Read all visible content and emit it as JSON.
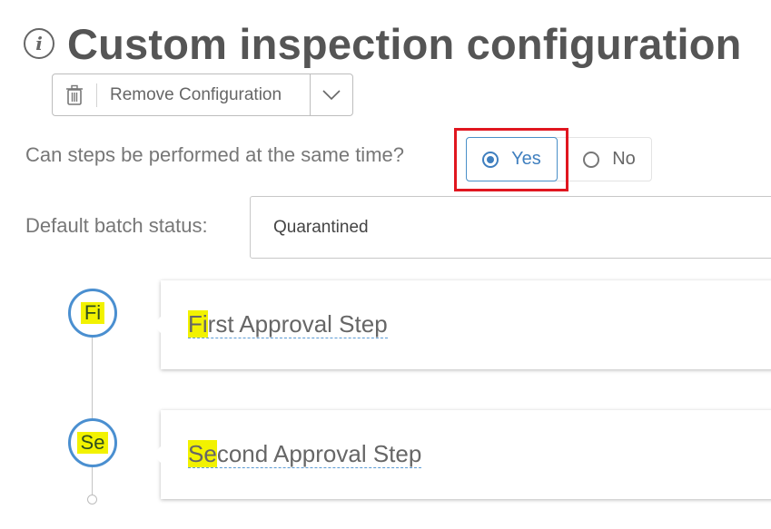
{
  "header": {
    "title": "Custom inspection configuration",
    "info_icon": "info-circle-icon"
  },
  "toolbar": {
    "remove_label": "Remove Configuration",
    "trash_icon": "trash-icon",
    "dropdown_icon": "chevron-down-icon"
  },
  "concurrency": {
    "question": "Can steps be performed at the same time?",
    "options": [
      {
        "label": "Yes",
        "selected": true
      },
      {
        "label": "No",
        "selected": false
      }
    ],
    "highlight_color": "#e0161f",
    "accent_color": "#3f7fbf"
  },
  "batch": {
    "label": "Default batch status:",
    "value": "Quarantined"
  },
  "steps": [
    {
      "badge": "Fi",
      "name_highlight": "Fi",
      "name_rest": "rst Approval Step"
    },
    {
      "badge": "Se",
      "name_highlight": "Se",
      "name_rest": "cond Approval Step"
    }
  ],
  "highlight_color": "#f2f200"
}
